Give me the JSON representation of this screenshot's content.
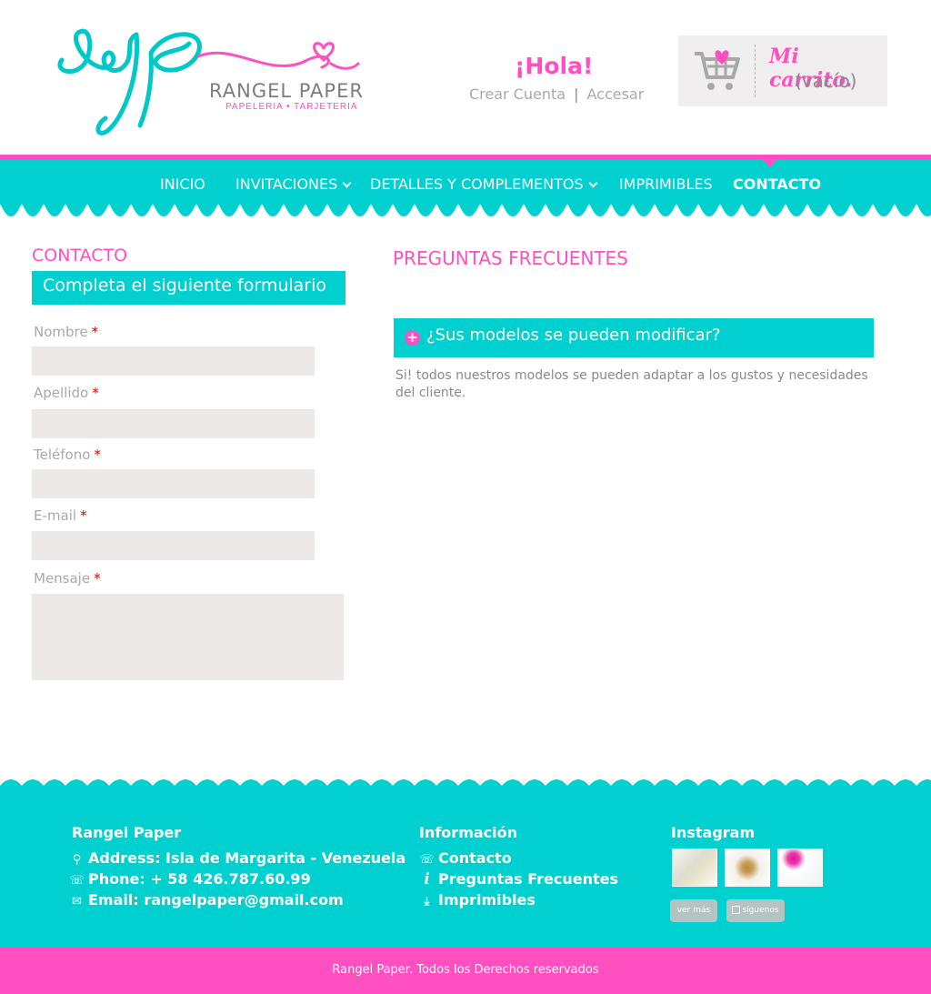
{
  "brand": {
    "monogram": "rp",
    "name": "RANGEL PAPER",
    "tagline": "PAPELERIA • TARJETERIA",
    "colors": {
      "primary": "#00d0d0",
      "accent": "#ff4fc0"
    }
  },
  "header": {
    "greeting": "¡Hola!",
    "create_account": "Crear Cuenta",
    "separator": "|",
    "login": "Accesar",
    "cart_title": "Mi carrito.",
    "cart_status": "(vacío)",
    "cart_icon": "shopping-cart-icon"
  },
  "nav": {
    "items": [
      {
        "label": "INICIO"
      },
      {
        "label": "INVITACIONES"
      },
      {
        "label": "DETALLES Y COMPLEMENTOS"
      },
      {
        "label": "IMPRIMIBLES"
      },
      {
        "label": "CONTACTO"
      }
    ],
    "active": "CONTACTO"
  },
  "contact": {
    "title": "CONTACTO",
    "banner": "Completa el siguiente formulario",
    "required_mark": "*",
    "fields": [
      {
        "label": "Nombre",
        "value": ""
      },
      {
        "label": "Apellido",
        "value": ""
      },
      {
        "label": "Teléfono",
        "value": ""
      },
      {
        "label": "E-mail",
        "value": ""
      },
      {
        "label": "Mensaje",
        "value": ""
      }
    ]
  },
  "faq": {
    "title": "PREGUNTAS FRECUENTES",
    "items": [
      {
        "question": "¿Sus modelos se pueden modificar?",
        "answer": "Si! todos nuestros modelos se pueden adaptar a los gustos y necesidades del cliente."
      }
    ]
  },
  "footer": {
    "company": {
      "title": "Rangel Paper",
      "address": "Address: Isla de Margarita - Venezuela",
      "phone": "Phone: + 58 426.787.60.99",
      "email": "Email: rangelpaper@gmail.com"
    },
    "info": {
      "title": "Información",
      "links": [
        "Contacto",
        "Preguntas Frecuentes",
        "Imprimibles"
      ]
    },
    "instagram": {
      "title": "Instagram",
      "see_more": "ver más",
      "follow": "síguenos"
    },
    "copyright": "Rangel Paper. Todos los Derechos reservados"
  }
}
